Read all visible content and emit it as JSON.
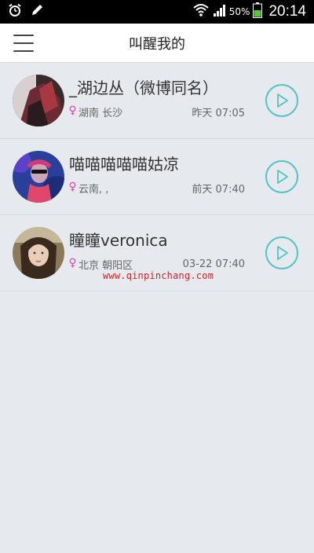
{
  "status_bar": {
    "battery_percent": "50%",
    "time": "20:14",
    "icons": [
      "alarm-icon",
      "pencil-icon",
      "wifi-icon",
      "signal-icon",
      "battery-icon"
    ]
  },
  "header": {
    "title": "叫醒我的",
    "menu_icon": "hamburger-menu-icon"
  },
  "items": [
    {
      "name": "_湖边丛（微博同名）",
      "location": "湖南 长沙",
      "time": "昨天  07:05"
    },
    {
      "name": "喵喵喵喵喵姑凉",
      "location": "云南, ,",
      "time": "前天  07:40"
    },
    {
      "name": "瞳瞳veronica",
      "location": "北京 朝阳区",
      "time": "03-22  07:40"
    }
  ],
  "watermark": "www.qinpinchang.com",
  "colors": {
    "accent": "#4fc4c9",
    "location_pin": "#e34fb0",
    "background": "#e6e9ed",
    "watermark": "#e02020"
  }
}
